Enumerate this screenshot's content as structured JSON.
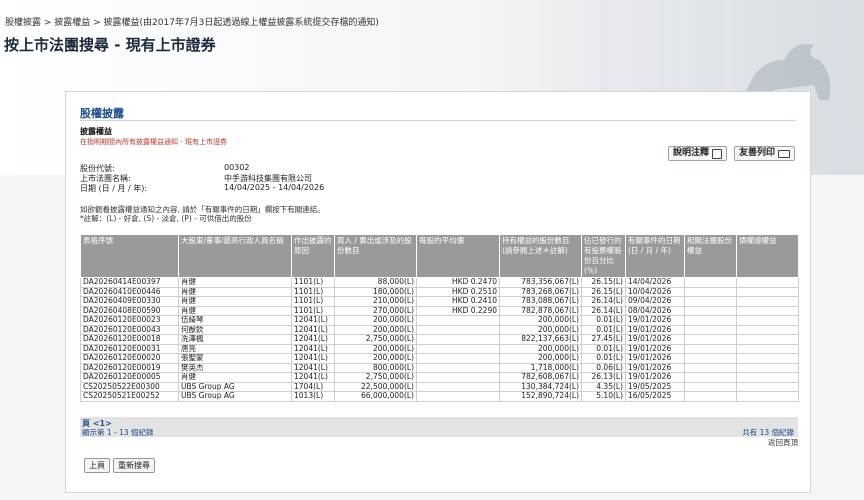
{
  "breadcrumb": "股權披露 > 披露權益 > 披露權益(由2017年7月3日起透過線上權益披露系統提交存檔的通知)",
  "page_title": "按上市法團搜尋 - 現有上市證券",
  "section_title": "股權披露",
  "sub_title": "披露權益",
  "sub_note": "在指明期間內所有披露權益通知 - 現有上市證券",
  "buttons": {
    "help": "說明注釋",
    "print": "友善列印",
    "prev_page": "上頁",
    "new_search": "重新搜尋"
  },
  "info": [
    {
      "label": "股份代號:",
      "value": "00302"
    },
    {
      "label": "上市法團名稱:",
      "value": "中手游科技集團有限公司"
    },
    {
      "label": "日期 (日 / 月 / 年):",
      "value": "14/04/2025 - 14/04/2026"
    }
  ],
  "instructions": [
    "如欲觀看披露權益通知之內容, 請於「有關事件的日期」欄按下有關連結。",
    "*註解：(L) - 好倉, (S) - 淡倉, (P) - 可供借出的股份"
  ],
  "table": {
    "headers": [
      "表格序號",
      "大股東/董事/最高行政人員名稱",
      "作出披露的原因",
      "買入 / 賣出或涉及的股份數目",
      "每股的平均價",
      "持有權益的股份數目(請參閱上述＊註解)",
      "佔已發行的有投票權股份百分比(％)",
      "有關事件的日期(日 / 月 / 年)",
      "相關法團股份權益",
      "債權證權益"
    ],
    "rows": [
      [
        "DA20260414E00397",
        "肖健",
        "1101(L)",
        "88,000(L)",
        "HKD 0.2470",
        "783,356,067(L)",
        "26.15(L)",
        "14/04/2026",
        "",
        ""
      ],
      [
        "DA20260410E00446",
        "肖健",
        "1101(L)",
        "180,000(L)",
        "HKD 0.2510",
        "783,268,067(L)",
        "26.15(L)",
        "10/04/2026",
        "",
        ""
      ],
      [
        "DA20260409E00330",
        "肖健",
        "1101(L)",
        "210,000(L)",
        "HKD 0.2410",
        "783,088,067(L)",
        "26.14(L)",
        "09/04/2026",
        "",
        ""
      ],
      [
        "DA20260408E00590",
        "肖健",
        "1101(L)",
        "270,000(L)",
        "HKD 0.2290",
        "782,878,067(L)",
        "26.14(L)",
        "08/04/2026",
        "",
        ""
      ],
      [
        "DA20260120E00023",
        "伍綺琴",
        "12041(L)",
        "200,000(L)",
        "",
        "200,000(L)",
        "0.01(L)",
        "19/01/2026",
        "",
        ""
      ],
      [
        "DA20260120E00043",
        "何猷欽",
        "12041(L)",
        "200,000(L)",
        "",
        "200,000(L)",
        "0.01(L)",
        "19/01/2026",
        "",
        ""
      ],
      [
        "DA20260120E00018",
        "冼澤楓",
        "12041(L)",
        "2,750,000(L)",
        "",
        "822,137,663(L)",
        "27.45(L)",
        "19/01/2026",
        "",
        ""
      ],
      [
        "DA20260120E00031",
        "唐亮",
        "12041(L)",
        "200,000(L)",
        "",
        "200,000(L)",
        "0.01(L)",
        "19/01/2026",
        "",
        ""
      ],
      [
        "DA20260120E00020",
        "張聖蒙",
        "12041(L)",
        "200,000(L)",
        "",
        "200,000(L)",
        "0.01(L)",
        "19/01/2026",
        "",
        ""
      ],
      [
        "DA20260120E00019",
        "樊英杰",
        "12041(L)",
        "800,000(L)",
        "",
        "1,718,000(L)",
        "0.06(L)",
        "19/01/2026",
        "",
        ""
      ],
      [
        "DA20260120E00005",
        "肖健",
        "12041(L)",
        "2,750,000(L)",
        "",
        "782,608,067(L)",
        "26.13(L)",
        "19/01/2026",
        "",
        ""
      ],
      [
        "CS20250522E00300",
        "UBS Group AG",
        "1704(L)",
        "22,500,000(L)",
        "",
        "130,384,724(L)",
        "4.35(L)",
        "19/05/2025",
        "",
        ""
      ],
      [
        "CS20250521E00252",
        "UBS Group AG",
        "1013(L)",
        "66,000,000(L)",
        "",
        "152,890,724(L)",
        "5.10(L)",
        "16/05/2025",
        "",
        ""
      ]
    ]
  },
  "pager": {
    "page_prefix": "頁",
    "page_current": "<1>",
    "showing": "顯示第 1 - 13 個紀錄",
    "total": "共有 13 個紀錄",
    "back_to_top": "返回頁頂"
  }
}
